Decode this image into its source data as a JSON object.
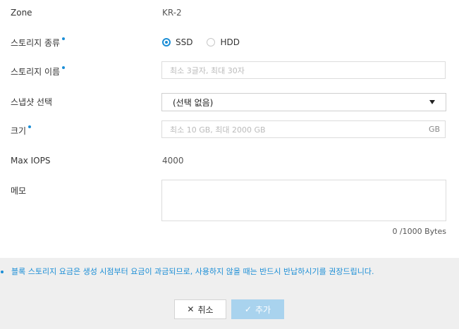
{
  "form": {
    "zone": {
      "label": "Zone",
      "value": "KR-2"
    },
    "storage_type": {
      "label": "스토리지 종류",
      "options": [
        "SSD",
        "HDD"
      ],
      "selected": "SSD"
    },
    "storage_name": {
      "label": "스토리지 이름",
      "placeholder": "최소 3글자, 최대 30자"
    },
    "snapshot": {
      "label": "스냅샷 선택",
      "selected": "(선택 없음)"
    },
    "size": {
      "label": "크기",
      "placeholder": "최소 10 GB, 최대 2000 GB",
      "unit": "GB"
    },
    "max_iops": {
      "label": "Max IOPS",
      "value": "4000"
    },
    "memo": {
      "label": "메모",
      "counter": "0 /1000 Bytes"
    }
  },
  "footer": {
    "notice": "블록 스토리지 요금은 생성 시점부터 요금이 과금되므로, 사용하지 않을 때는 반드시 반납하시기를 권장드립니다.",
    "cancel_label": "취소",
    "add_label": "추가"
  },
  "colors": {
    "accent": "#1b8ed6",
    "disabled_button": "#a9d3ee",
    "footer_bg": "#efefef"
  }
}
